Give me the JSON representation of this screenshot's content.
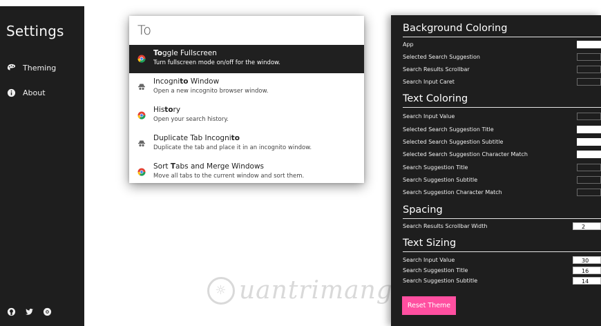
{
  "sidebar": {
    "title": "Settings",
    "items": [
      {
        "label": "Theming",
        "icon": "palette-icon"
      },
      {
        "label": "About",
        "icon": "info-icon"
      }
    ],
    "social": [
      "github-icon",
      "twitter-icon",
      "chrome-icon"
    ]
  },
  "search": {
    "value": "To",
    "suggestions": [
      {
        "title_pre": "",
        "title_match": "To",
        "title_post": "ggle Fullscreen",
        "subtitle": "Turn fullscreen mode on/off for the window.",
        "icon": "chrome-icon",
        "selected": true
      },
      {
        "title_pre": "Incogni",
        "title_match": "to",
        "title_post": " Window",
        "subtitle": "Open a new incognito browser window.",
        "icon": "incognito-icon",
        "selected": false
      },
      {
        "title_pre": "His",
        "title_match": "to",
        "title_post": "ry",
        "subtitle": "Open your search history.",
        "icon": "chrome-icon",
        "selected": false
      },
      {
        "title_pre": "Duplicate Tab Incogni",
        "title_match": "to",
        "title_post": "",
        "subtitle": "Duplicate the tab and place it in an incognito window.",
        "icon": "incognito-icon",
        "selected": false
      },
      {
        "title_pre": "Sort ",
        "title_match": "T",
        "title_post": "abs and Merge Windows",
        "subtitle": "Move all tabs to the current window and sort them.",
        "icon": "chrome-icon",
        "selected": false
      }
    ]
  },
  "panel": {
    "background_coloring": {
      "title": "Background Coloring",
      "rows": [
        "App",
        "Selected Search Suggestion",
        "Search Results Scrollbar",
        "Search Input Caret"
      ]
    },
    "text_coloring": {
      "title": "Text Coloring",
      "rows": [
        "Search Input Value",
        "Selected Search Suggestion Title",
        "Selected Search Suggestion Subtitle",
        "Selected Search Suggestion Character Match",
        "Search Suggestion Title",
        "Search Suggestion Subtitle",
        "Search Suggestion Character Match"
      ]
    },
    "spacing": {
      "title": "Spacing",
      "rows": [
        {
          "label": "Search Results Scrollbar Width",
          "value": "2"
        }
      ]
    },
    "text_sizing": {
      "title": "Text Sizing",
      "rows": [
        {
          "label": "Search Input Value",
          "value": "30"
        },
        {
          "label": "Search Suggestion Title",
          "value": "16"
        },
        {
          "label": "Search Suggestion Subtitle",
          "value": "14"
        }
      ]
    },
    "reset_label": "Reset Theme"
  },
  "watermark": "uantrimang",
  "colors": {
    "dark": "#1e1e1e",
    "accent": "#ff4fa0",
    "white": "#ffffff"
  }
}
